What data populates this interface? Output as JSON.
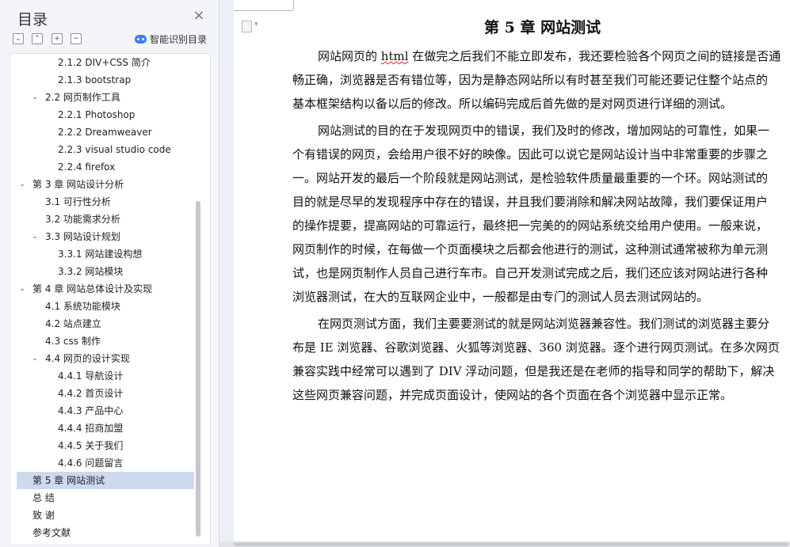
{
  "toc": {
    "title": "目录",
    "close_icon": "close-icon",
    "tools": [
      "expand-all-icon",
      "collapse-up-icon",
      "add-level-icon",
      "remove-level-icon"
    ],
    "smart_label": "智能识别目录",
    "items": [
      {
        "text": "2.1.2 DIV+CSS 简介",
        "level": 3,
        "caret": ""
      },
      {
        "text": "2.1.3 bootstrap",
        "level": 3,
        "caret": ""
      },
      {
        "text": "2.2  网页制作工具",
        "level": 2,
        "caret": "⌄"
      },
      {
        "text": "2.2.1 Photoshop",
        "level": 3,
        "caret": ""
      },
      {
        "text": "2.2.2 Dreamweaver",
        "level": 3,
        "caret": ""
      },
      {
        "text": "2.2.3 visual studio code",
        "level": 3,
        "caret": ""
      },
      {
        "text": "2.2.4 firefox",
        "level": 3,
        "caret": ""
      },
      {
        "text": "第 3 章  网站设计分析",
        "level": 1,
        "caret": "⌄"
      },
      {
        "text": "3.1  可行性分析",
        "level": 2,
        "caret": ""
      },
      {
        "text": "3.2  功能需求分析",
        "level": 2,
        "caret": ""
      },
      {
        "text": "3.3  网站设计规划",
        "level": 2,
        "caret": "⌄"
      },
      {
        "text": "3.3.1  网站建设构想",
        "level": 3,
        "caret": ""
      },
      {
        "text": "3.3.2  网站模块",
        "level": 3,
        "caret": ""
      },
      {
        "text": "第 4 章  网站总体设计及实现",
        "level": 1,
        "caret": "⌄"
      },
      {
        "text": "4.1  系统功能模块",
        "level": 2,
        "caret": ""
      },
      {
        "text": "4.2  站点建立",
        "level": 2,
        "caret": ""
      },
      {
        "text": "4.3 css 制作",
        "level": 2,
        "caret": ""
      },
      {
        "text": "4.4  网页的设计实现",
        "level": 2,
        "caret": "⌄"
      },
      {
        "text": "4.4.1  导航设计",
        "level": 3,
        "caret": ""
      },
      {
        "text": "4.4.2  首页设计",
        "level": 3,
        "caret": ""
      },
      {
        "text": "4.4.3  产品中心",
        "level": 3,
        "caret": ""
      },
      {
        "text": "4.4.4  招商加盟",
        "level": 3,
        "caret": ""
      },
      {
        "text": "4.4.5  关于我们",
        "level": 3,
        "caret": ""
      },
      {
        "text": "4.4.6  问题留言",
        "level": 3,
        "caret": ""
      },
      {
        "text": "第 5 章  网站测试",
        "level": 1,
        "caret": "",
        "active": true
      },
      {
        "text": "总    结",
        "level": 1,
        "caret": ""
      },
      {
        "text": "致    谢",
        "level": 1,
        "caret": ""
      },
      {
        "text": "参考文献",
        "level": 1,
        "caret": ""
      }
    ]
  },
  "document": {
    "heading": "第 5 章  网站测试",
    "lines": [
      {
        "pre": "网站网页的 ",
        "spell": "html",
        "text": " 在做完之后我们不能立即发布，我还要检验各个网页之间的链接是否通",
        "indent": true
      },
      {
        "text": "畅正确，浏览器是否有错位等，因为是静态网站所以有时甚至我们可能还要记住整个站点的"
      },
      {
        "text": "基本框架结构以备以后的修改。所以编码完成后首先做的是对网页进行详细的测试。"
      },
      {
        "text": "网站测试的目的在于发现网页中的错误，我们及时的修改，增加网站的可靠性，如果一",
        "indent": true
      },
      {
        "text": "个有错误的网页，会给用户很不好的映像。因此可以说它是网站设计当中非常重要的步骤之"
      },
      {
        "text": "一。网站开发的最后一个阶段就是网站测试，是检验软件质量最重要的一个环。网站测试的"
      },
      {
        "text": "目的就是尽早的发现程序中存在的错误，并且我们要消除和解决网站故障，我们要保证用户"
      },
      {
        "text": "的操作提要，提高网站的可靠运行，最终把一完美的的网站系统交给用户使用。一般来说，"
      },
      {
        "text": "网页制作的时候，在每做一个页面模块之后都会他进行的测试，这种测试通常被称为单元测"
      },
      {
        "text": "试，也是网页制作人员自己进行车市。自己开发测试完成之后，我们还应该对网站进行各种"
      },
      {
        "text": "浏览器测试，在大的互联网企业中，一般都是由专门的测试人员去测试网站的。"
      },
      {
        "text": "在网页测试方面，我们主要要测试的就是网站浏览器兼容性。我们测试的浏览器主要分",
        "indent": true
      },
      {
        "text": "布是 IE 浏览器、谷歌浏览器、火狐等浏览器、360 浏览器。逐个进行网页测试。在多次网页"
      },
      {
        "text": "兼容实践中经常可以遇到了 DIV 浮动问题，但是我还是在老师的指导和同学的帮助下，解决"
      },
      {
        "text": "这些网页兼容问题，并完成页面设计，使网站的各个页面在各个浏览器中显示正常。"
      }
    ]
  }
}
